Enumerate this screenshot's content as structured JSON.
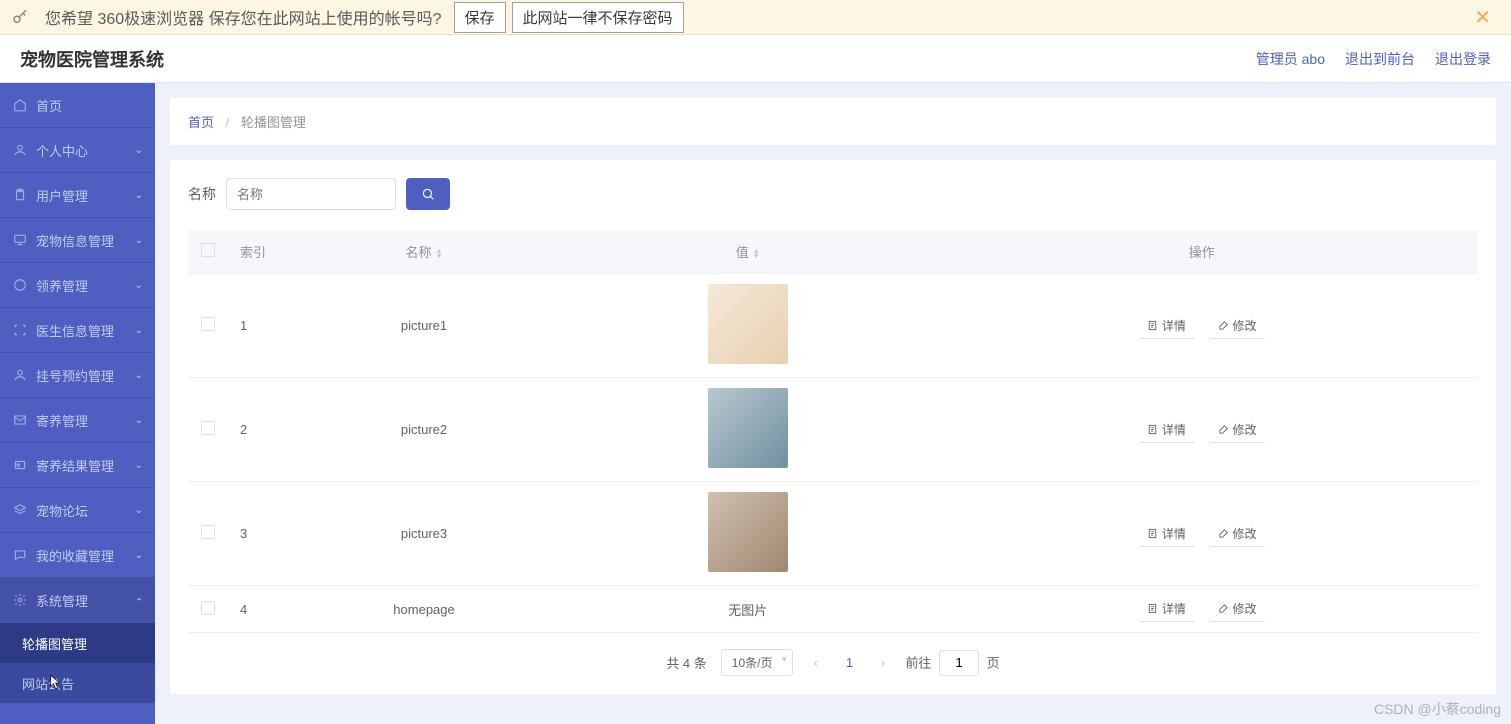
{
  "browser_bar": {
    "message": "您希望 360极速浏览器 保存您在此网站上使用的帐号吗?",
    "save_btn": "保存",
    "never_btn": "此网站一律不保存密码"
  },
  "header": {
    "title": "宠物医院管理系统",
    "admin_label": "管理员 abo",
    "exit_front": "退出到前台",
    "logout": "退出登录"
  },
  "sidebar": {
    "items": [
      {
        "label": "首页",
        "icon": "home",
        "expandable": false
      },
      {
        "label": "个人中心",
        "icon": "user",
        "expandable": true
      },
      {
        "label": "用户管理",
        "icon": "clipboard",
        "expandable": true
      },
      {
        "label": "宠物信息管理",
        "icon": "monitor",
        "expandable": true
      },
      {
        "label": "领养管理",
        "icon": "circle",
        "expandable": true
      },
      {
        "label": "医生信息管理",
        "icon": "scan",
        "expandable": true
      },
      {
        "label": "挂号预约管理",
        "icon": "user",
        "expandable": true
      },
      {
        "label": "寄养管理",
        "icon": "mail",
        "expandable": true
      },
      {
        "label": "寄养结果管理",
        "icon": "badge",
        "expandable": true
      },
      {
        "label": "宠物论坛",
        "icon": "layers",
        "expandable": true
      },
      {
        "label": "我的收藏管理",
        "icon": "chat",
        "expandable": true
      },
      {
        "label": "系统管理",
        "icon": "gear",
        "expandable": true,
        "expanded": true,
        "children": [
          {
            "label": "轮播图管理",
            "active": true
          },
          {
            "label": "网站公告",
            "active": false
          }
        ]
      }
    ]
  },
  "breadcrumb": {
    "home": "首页",
    "current": "轮播图管理"
  },
  "search": {
    "label": "名称",
    "placeholder": "名称"
  },
  "table": {
    "headers": {
      "index": "索引",
      "name": "名称",
      "value": "值",
      "action": "操作"
    },
    "rows": [
      {
        "index": "1",
        "name": "picture1",
        "value_type": "img1"
      },
      {
        "index": "2",
        "name": "picture2",
        "value_type": "img2"
      },
      {
        "index": "3",
        "name": "picture3",
        "value_type": "img3"
      },
      {
        "index": "4",
        "name": "homepage",
        "value_type": "none",
        "no_img_text": "无图片"
      }
    ],
    "actions": {
      "detail": "详情",
      "edit": "修改"
    }
  },
  "pagination": {
    "total": "共 4 条",
    "page_size": "10条/页",
    "current": "1",
    "goto_prefix": "前往",
    "goto_value": "1",
    "goto_suffix": "页"
  },
  "watermark": "CSDN @小蔡coding"
}
